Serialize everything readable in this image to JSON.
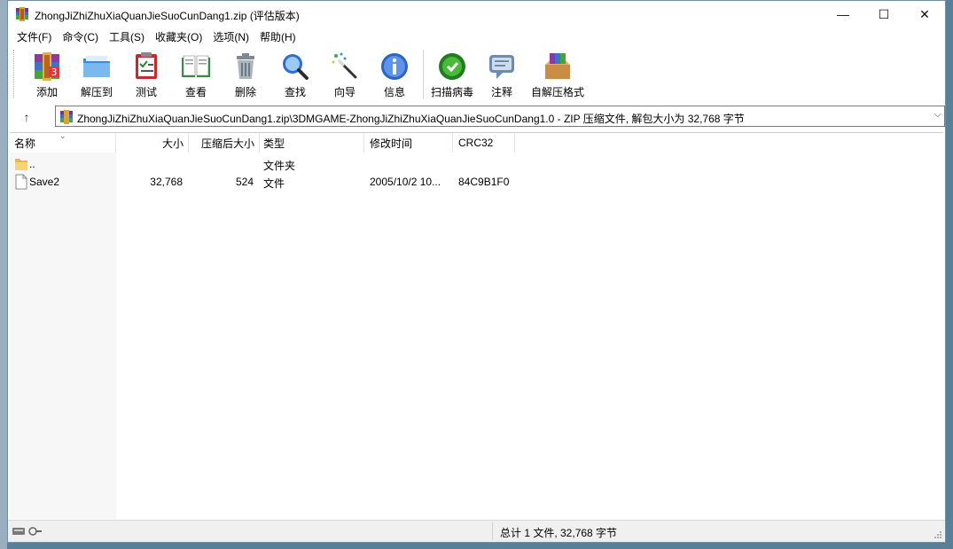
{
  "window": {
    "title": "ZhongJiZhiZhuXiaQuanJieSuoCunDang1.zip (评估版本)",
    "minimize": "—",
    "maximize": "☐",
    "close": "✕"
  },
  "menu": [
    "文件(F)",
    "命令(C)",
    "工具(S)",
    "收藏夹(O)",
    "选项(N)",
    "帮助(H)"
  ],
  "toolbar": {
    "add": "添加",
    "extract": "解压到",
    "test": "测试",
    "view": "查看",
    "delete": "删除",
    "find": "查找",
    "wizard": "向导",
    "info": "信息",
    "scan": "扫描病毒",
    "comment": "注释",
    "sfx": "自解压格式"
  },
  "address": {
    "up": "↑",
    "path": "ZhongJiZhiZhuXiaQuanJieSuoCunDang1.zip\\3DMGAME-ZhongJiZhiZhuXiaQuanJieSuoCunDang1.0 - ZIP 压缩文件, 解包大小为 32,768 字节",
    "dropdown": "⌵"
  },
  "columns": {
    "name": "名称",
    "size": "大小",
    "packed": "压缩后大小",
    "type": "类型",
    "modified": "修改时间",
    "crc": "CRC32"
  },
  "rows": [
    {
      "name": "..",
      "size": "",
      "packed": "",
      "type": "文件夹",
      "modified": "",
      "crc": "",
      "icon": "folder-icon"
    },
    {
      "name": "Save2",
      "size": "32,768",
      "packed": "524",
      "type": "文件",
      "modified": "2005/10/2 10...",
      "crc": "84C9B1F0",
      "icon": "file-icon"
    }
  ],
  "status": {
    "summary": "总计 1 文件, 32,768 字节"
  }
}
